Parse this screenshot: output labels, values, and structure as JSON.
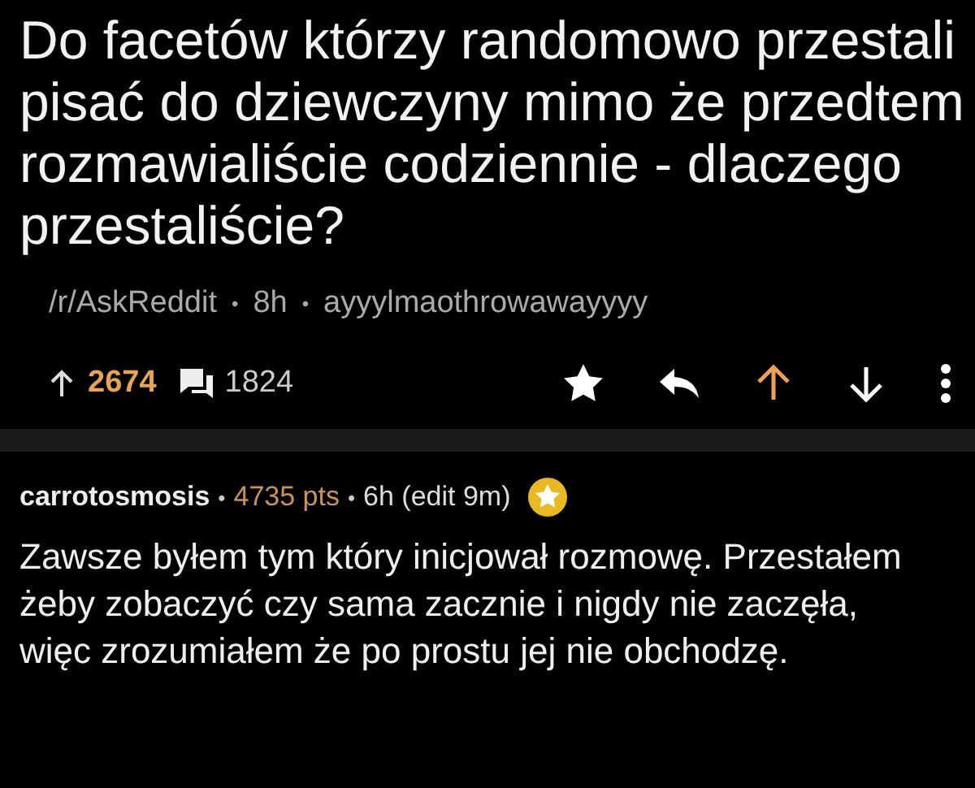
{
  "post": {
    "title": "Do facetów którzy randomowo przestali pisać do dziewczyny mimo że przedtem rozmawialiście codziennie - dlaczego przestaliście?",
    "subreddit": "/r/AskReddit",
    "age": "8h",
    "author": "ayyylmaothrowawayyyy",
    "score": "2674",
    "comments": "1824",
    "upvoted": true,
    "separators": [
      "•",
      "•"
    ]
  },
  "comment": {
    "author": "carrotosmosis",
    "points": "4735 pts",
    "age": "6h (edit 9m)",
    "gilded": true,
    "separators": [
      "•",
      "•"
    ],
    "body": "Zawsze byłem tym który inicjował rozmowę. Przestałem żeby zobaczyć czy sama zacznie i nigdy nie zaczęła, więc zrozumiałem że po prostu jej nie obchodzę."
  }
}
